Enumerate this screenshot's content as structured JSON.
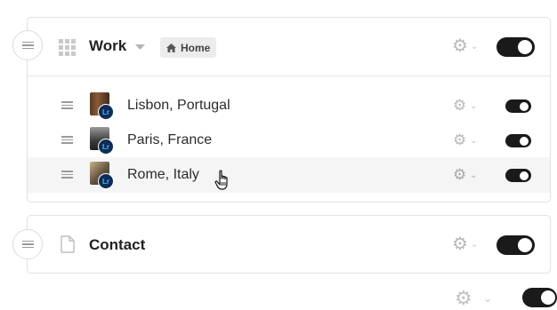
{
  "nav": {
    "work": {
      "title": "Work",
      "badge": "Home",
      "items": [
        {
          "label": "Lisbon, Portugal",
          "icon": "lightroom-icon"
        },
        {
          "label": "Paris, France",
          "icon": "lightroom-icon"
        },
        {
          "label": "Rome, Italy",
          "icon": "lightroom-icon"
        }
      ]
    },
    "contact": {
      "title": "Contact"
    }
  },
  "colors": {
    "toggle_on": "#1a1a1a",
    "lightroom_badge": "#0c2d55",
    "lightroom_text": "#4fb4ff",
    "hover_row": "#f5f5f5"
  }
}
